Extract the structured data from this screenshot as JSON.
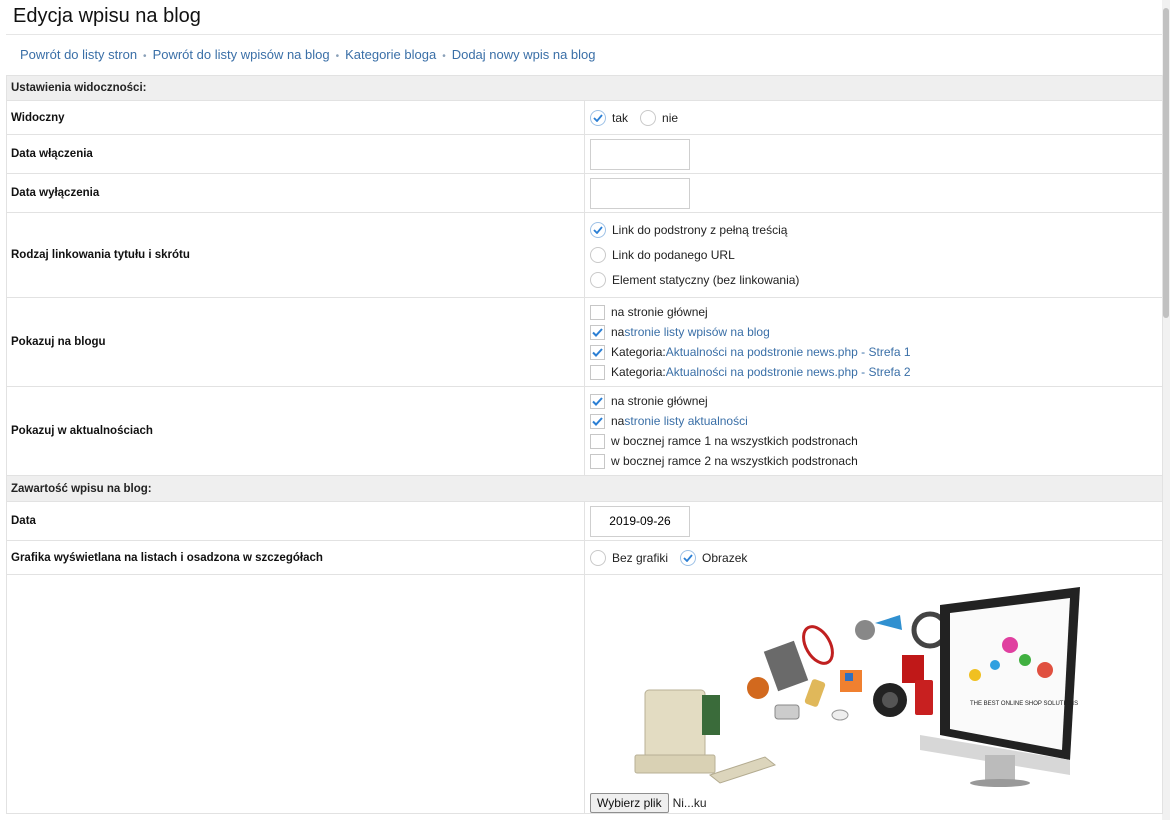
{
  "page": {
    "title": "Edycja wpisu na blog"
  },
  "breadcrumb": [
    "Powrót do listy stron",
    "Powrót do listy wpisów na blog",
    "Kategorie bloga",
    "Dodaj nowy wpis na blog"
  ],
  "breadcrumb_separator": "•",
  "visibility": {
    "section": "Ustawienia widoczności:",
    "visible": {
      "label": "Widoczny",
      "opt_yes": "tak",
      "opt_no": "nie",
      "selected": "tak"
    },
    "start_date": {
      "label": "Data włączenia",
      "value": ""
    },
    "end_date": {
      "label": "Data wyłączenia",
      "value": ""
    },
    "link_type": {
      "label": "Rodzaj linkowania tytułu i skrótu",
      "options": [
        "Link do podstrony z pełną treścią",
        "Link do podanego URL",
        "Element statyczny (bez linkowania)"
      ],
      "selected_index": 0
    },
    "show_blog": {
      "label": "Pokazuj na blogu",
      "items": [
        {
          "prefix": "na stronie głównej",
          "link": "",
          "checked": false
        },
        {
          "prefix": "na ",
          "link": "stronie listy wpisów na blog",
          "checked": true
        },
        {
          "prefix": "Kategoria: ",
          "link": "Aktualności na podstronie news.php - Strefa 1",
          "checked": true
        },
        {
          "prefix": "Kategoria: ",
          "link": "Aktualności na podstronie news.php - Strefa 2",
          "checked": false
        }
      ]
    },
    "show_news": {
      "label": "Pokazuj w aktualnościach",
      "items": [
        {
          "prefix": "na stronie głównej",
          "link": "",
          "checked": true
        },
        {
          "prefix": "na ",
          "link": "stronie listy aktualności",
          "checked": true
        },
        {
          "prefix": "w bocznej ramce 1 na wszystkich podstronach",
          "link": "",
          "checked": false
        },
        {
          "prefix": "w bocznej ramce 2 na wszystkich podstronach",
          "link": "",
          "checked": false
        }
      ]
    }
  },
  "content": {
    "section": "Zawartość wpisu na blog:",
    "date": {
      "label": "Data",
      "value": "2019-09-26"
    },
    "graphic": {
      "label": "Grafika wyświetlana na listach i osadzona w szczegółach",
      "opt_none": "Bez grafiki",
      "opt_image": "Obrazek",
      "selected": "Obrazek"
    },
    "image_caption": "THE BEST ONLINE SHOP SOLUTIONS",
    "file": {
      "button": "Wybierz plik",
      "name": "Ni...ku"
    }
  },
  "colors": {
    "link": "#3a6fa7",
    "check": "#2b7fd4",
    "section_bg": "#efefef"
  }
}
